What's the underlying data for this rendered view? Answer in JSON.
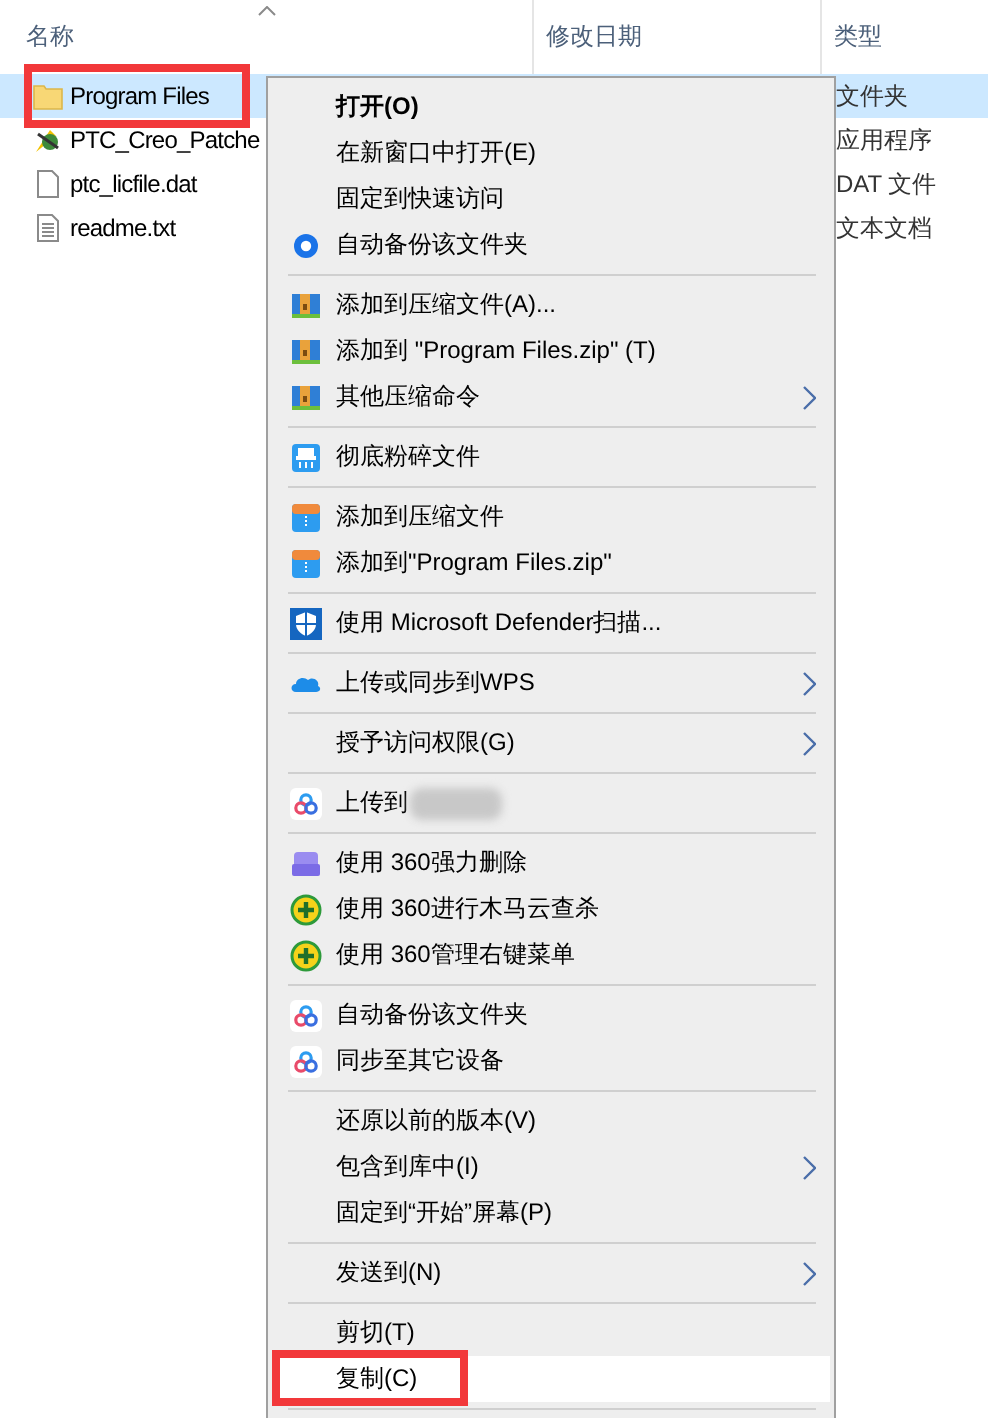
{
  "columns": [
    {
      "label": "名称",
      "sorted": true
    },
    {
      "label": "修改日期",
      "sorted": false
    },
    {
      "label": "类型",
      "sorted": false
    }
  ],
  "files": [
    {
      "name": "Program Files",
      "type": "文件夹",
      "kind": "folder",
      "selected": true,
      "annotated": true
    },
    {
      "name": "PTC_Creo_Patche",
      "type": "应用程序",
      "kind": "app",
      "selected": false,
      "annotated": false
    },
    {
      "name": "ptc_licfile.dat",
      "type": "DAT 文件",
      "kind": "file",
      "selected": false,
      "annotated": false
    },
    {
      "name": "readme.txt",
      "type": "文本文档",
      "kind": "text",
      "selected": false,
      "annotated": false
    }
  ],
  "context_menu": {
    "groups": [
      [
        {
          "label": "打开(O)",
          "kind": "default",
          "submenu": false,
          "selected": false,
          "annotated": false
        },
        {
          "label": "在新窗口中打开(E)",
          "kind": "command",
          "submenu": false,
          "selected": false,
          "annotated": false
        },
        {
          "label": "固定到快速访问",
          "kind": "command",
          "submenu": false,
          "selected": false,
          "annotated": false
        },
        {
          "label": "自动备份该文件夹",
          "kind": "command",
          "submenu": false,
          "selected": false,
          "annotated": false
        }
      ],
      [
        {
          "label": "添加到压缩文件(A)...",
          "kind": "command",
          "submenu": false,
          "selected": false,
          "annotated": false
        },
        {
          "label": "添加到 \"Program Files.zip\" (T)",
          "kind": "command",
          "submenu": false,
          "selected": false,
          "annotated": false
        },
        {
          "label": "其他压缩命令",
          "kind": "command",
          "submenu": true,
          "selected": false,
          "annotated": false
        }
      ],
      [
        {
          "label": "彻底粉碎文件",
          "kind": "command",
          "submenu": false,
          "selected": false,
          "annotated": false
        }
      ],
      [
        {
          "label": "添加到压缩文件",
          "kind": "command",
          "submenu": false,
          "selected": false,
          "annotated": false
        },
        {
          "label": "添加到\"Program Files.zip\"",
          "kind": "command",
          "submenu": false,
          "selected": false,
          "annotated": false
        }
      ],
      [
        {
          "label": "使用 Microsoft Defender扫描...",
          "kind": "command",
          "submenu": false,
          "selected": false,
          "annotated": false
        }
      ],
      [
        {
          "label": "上传或同步到WPS",
          "kind": "command",
          "submenu": true,
          "selected": false,
          "annotated": false
        }
      ],
      [
        {
          "label": "授予访问权限(G)",
          "kind": "command",
          "submenu": true,
          "selected": false,
          "annotated": false
        }
      ],
      [
        {
          "label": "上传到",
          "kind": "blurred",
          "submenu": false,
          "selected": false,
          "annotated": false
        }
      ],
      [
        {
          "label": "使用 360强力删除",
          "kind": "command",
          "submenu": false,
          "selected": false,
          "annotated": false
        },
        {
          "label": "使用 360进行木马云查杀",
          "kind": "command",
          "submenu": false,
          "selected": false,
          "annotated": false
        },
        {
          "label": "使用 360管理右键菜单",
          "kind": "command",
          "submenu": false,
          "selected": false,
          "annotated": false
        }
      ],
      [
        {
          "label": "自动备份该文件夹",
          "kind": "command",
          "submenu": false,
          "selected": false,
          "annotated": false
        },
        {
          "label": "同步至其它设备",
          "kind": "command",
          "submenu": false,
          "selected": false,
          "annotated": false
        }
      ],
      [
        {
          "label": "还原以前的版本(V)",
          "kind": "command",
          "submenu": false,
          "selected": false,
          "annotated": false
        },
        {
          "label": "包含到库中(I)",
          "kind": "command",
          "submenu": true,
          "selected": false,
          "annotated": false
        },
        {
          "label": "固定到“开始”屏幕(P)",
          "kind": "command",
          "submenu": false,
          "selected": false,
          "annotated": false
        }
      ],
      [
        {
          "label": "发送到(N)",
          "kind": "command",
          "submenu": true,
          "selected": false,
          "annotated": false
        }
      ],
      [
        {
          "label": "剪切(T)",
          "kind": "command",
          "submenu": false,
          "selected": false,
          "annotated": false
        },
        {
          "label": "复制(C)",
          "kind": "command",
          "submenu": false,
          "selected": true,
          "annotated": true
        }
      ]
    ]
  }
}
